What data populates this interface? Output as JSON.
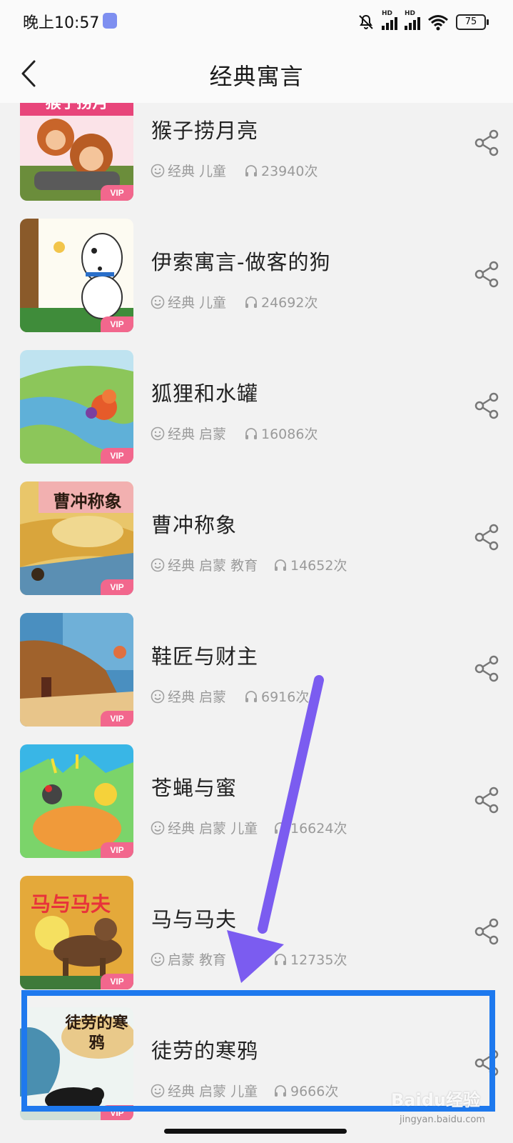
{
  "status_bar": {
    "time": "晚上10:57",
    "battery": "75",
    "icons": [
      "app-notification-icon",
      "mute-bell-icon",
      "hd-signal-icon",
      "hd-signal-icon",
      "wifi-icon",
      "battery-icon"
    ]
  },
  "header": {
    "title": "经典寓言",
    "back_icon": "chevron-left-icon"
  },
  "list": {
    "vip_label": "VIP",
    "items": [
      {
        "title": "猴子捞月亮",
        "tags": "经典  儿童",
        "plays": "23940次",
        "cover_text": "猴子捞月"
      },
      {
        "title": "伊索寓言-做客的狗",
        "tags": "经典  儿童",
        "plays": "24692次",
        "cover_text": ""
      },
      {
        "title": "狐狸和水罐",
        "tags": "经典  启蒙",
        "plays": "16086次",
        "cover_text": ""
      },
      {
        "title": "曹冲称象",
        "tags": "经典  启蒙  教育",
        "plays": "14652次",
        "cover_text": "曹冲称象"
      },
      {
        "title": "鞋匠与财主",
        "tags": "经典  启蒙",
        "plays": "6916次",
        "cover_text": ""
      },
      {
        "title": "苍蝇与蜜",
        "tags": "经典  启蒙  儿童",
        "plays": "16624次",
        "cover_text": ""
      },
      {
        "title": "马与马夫",
        "tags": "启蒙  教育",
        "plays": "12735次",
        "cover_text": "马与马夫"
      },
      {
        "title": "徒劳的寒鸦",
        "tags": "经典  启蒙  儿童",
        "plays": "9666次",
        "cover_text": "徒劳的寒鸦"
      }
    ]
  },
  "annotation": {
    "arrow_color": "#7b5cf0",
    "box_color": "#1e79ee"
  },
  "watermark": {
    "brand": "Baidu经验",
    "url": "jingyan.baidu.com"
  },
  "colors": {
    "vip_badge": "#f2678d",
    "meta_text": "#9a9a9a",
    "background": "#f2f2f2"
  }
}
